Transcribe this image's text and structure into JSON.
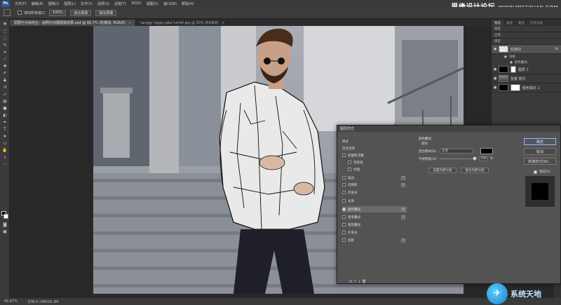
{
  "menu": {
    "app_badge": "Ps",
    "items": [
      "文件(F)",
      "编辑(E)",
      "图像(I)",
      "图层(L)",
      "文字(Y)",
      "选择(S)",
      "滤镜(T)",
      "3D(D)",
      "视图(V)",
      "窗口(W)",
      "帮助(H)"
    ],
    "watermark": "思缘设计论坛",
    "watermark_url": "WWW.MISSYUAN.COM"
  },
  "options_bar": {
    "scroll_all": "滚动所有窗口",
    "zoom": "100%",
    "fit_screen": "适合屏幕",
    "fill_screen": "填充屏幕"
  },
  "tabs": [
    {
      "label": "原图与手绘结合：给照片创建服装效果.psd @ 66.7% (轮廓线, RGB/8)",
      "close": "×"
    },
    {
      "label": "tanggy rogan jake turrell.jpg @ 50% (RGB/8)",
      "close": "×"
    }
  ],
  "layers_panel": {
    "tabs": [
      "图层",
      "通道",
      "路径",
      "历史记录"
    ],
    "kind_row": "类型",
    "mode_row": "正常",
    "lock_row": "锁定",
    "layers": [
      {
        "name": "轮廓线",
        "fx": "fx",
        "selected": true
      },
      {
        "name": "效果",
        "sub": true
      },
      {
        "name": "颜色叠加",
        "sub": true
      },
      {
        "name": "图层 1"
      },
      {
        "name": "背景 拷贝"
      },
      {
        "name": "颜色填充 1"
      }
    ]
  },
  "dialog": {
    "title": "图层样式",
    "list": [
      {
        "label": "样式",
        "kind": "header"
      },
      {
        "label": "混合选项",
        "kind": "header"
      },
      {
        "label": "斜面和浮雕",
        "kind": "check",
        "on": false
      },
      {
        "label": "等高线",
        "kind": "check",
        "on": false
      },
      {
        "label": "纹理",
        "kind": "check",
        "on": false
      },
      {
        "label": "描边",
        "kind": "check",
        "on": false,
        "plus": true
      },
      {
        "label": "内阴影",
        "kind": "check",
        "on": false,
        "plus": true
      },
      {
        "label": "内发光",
        "kind": "check",
        "on": false
      },
      {
        "label": "光泽",
        "kind": "check",
        "on": false
      },
      {
        "label": "颜色叠加",
        "kind": "check",
        "on": true,
        "plus": true,
        "selected": true
      },
      {
        "label": "渐变叠加",
        "kind": "check",
        "on": false,
        "plus": true
      },
      {
        "label": "图案叠加",
        "kind": "check",
        "on": false
      },
      {
        "label": "外发光",
        "kind": "check",
        "on": false
      },
      {
        "label": "投影",
        "kind": "check",
        "on": false,
        "plus": true
      }
    ],
    "section_title": "颜色叠加",
    "section_sub": "颜色",
    "blend_mode_label": "混合模式(B):",
    "blend_mode_value": "正常",
    "opacity_label": "不透明度(O):",
    "opacity_value": "100",
    "opacity_unit": "%",
    "set_default": "设置为默认值",
    "reset_default": "复位为默认值",
    "ok": "确定",
    "cancel": "取消",
    "new_style": "新建样式(W)...",
    "preview": "预览(V)",
    "fx_icons": "fx  ↑  ↓  🗑"
  },
  "status": {
    "zoom": "66.67%",
    "doc": "文档:4.14M/26.3M"
  },
  "watermark_bottom": {
    "text": "系统天地"
  }
}
